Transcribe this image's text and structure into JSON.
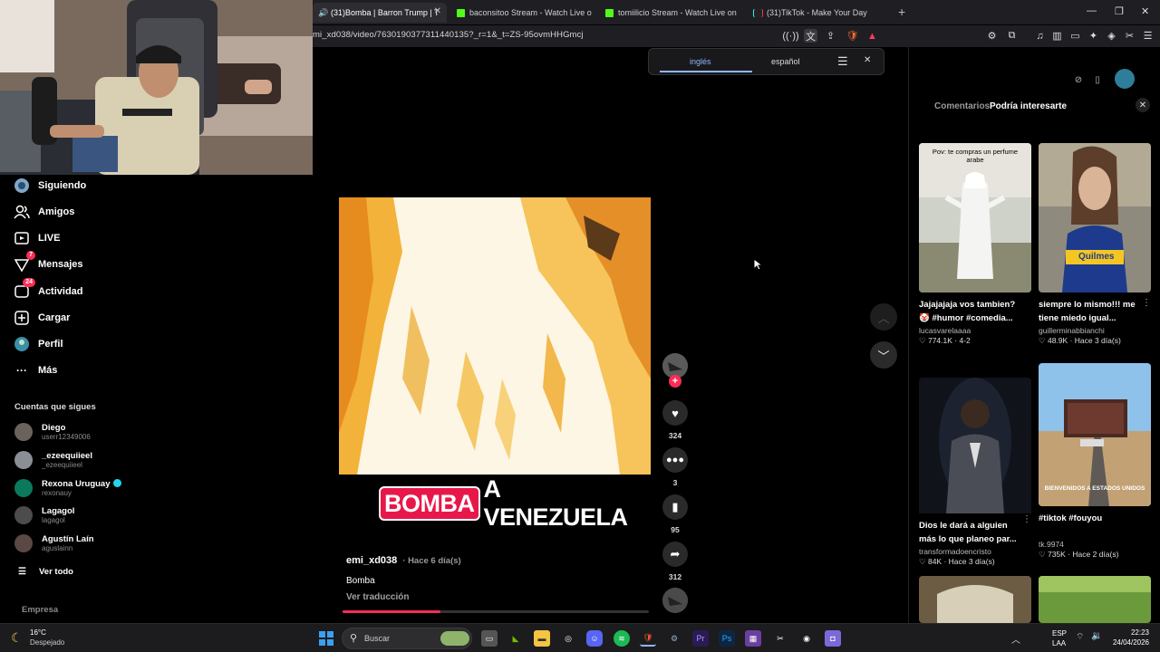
{
  "browser": {
    "tabs": [
      {
        "label": "(31)Bomba | Barron Trump | T",
        "active": true
      },
      {
        "label": "baconsitoo Stream - Watch Live o",
        "active": false
      },
      {
        "label": "tomiilicio Stream - Watch Live on",
        "active": false
      },
      {
        "label": "(31)TikTok - Make Your Day",
        "active": false
      }
    ],
    "url": "mi_xd038/video/7630190377311440135?_r=1&_t=ZS-95ovmHHGmcj"
  },
  "translate": {
    "lang1": "inglés",
    "lang2": "español"
  },
  "sidebar": {
    "nav": [
      {
        "label": "Siguiendo",
        "icon": "following-icon"
      },
      {
        "label": "Amigos",
        "icon": "friends-icon"
      },
      {
        "label": "LIVE",
        "icon": "live-icon"
      },
      {
        "label": "Mensajes",
        "icon": "messages-icon",
        "badge": "7"
      },
      {
        "label": "Actividad",
        "icon": "activity-icon",
        "badge": "24"
      },
      {
        "label": "Cargar",
        "icon": "upload-icon"
      },
      {
        "label": "Perfil",
        "icon": "profile-icon"
      },
      {
        "label": "Más",
        "icon": "more-icon"
      }
    ],
    "section_title": "Cuentas que sigues",
    "accounts": [
      {
        "name": "Diego",
        "handle": "userr12349006",
        "verified": false
      },
      {
        "name": "_ezeequiieel",
        "handle": "_ezeequiieel",
        "verified": false
      },
      {
        "name": "Rexona Uruguay",
        "handle": "rexonauy",
        "verified": true
      },
      {
        "name": "Lagagol",
        "handle": "lagagol",
        "verified": false
      },
      {
        "name": "Agustín Laín",
        "handle": "aguslainn",
        "verified": false
      }
    ],
    "see_all": "Ver todo",
    "footer": "Empresa"
  },
  "video": {
    "caption_highlight": "BOMBA",
    "caption_rest": "A VENEZUELA",
    "author": "emi_xd038",
    "time": "· Hace 6 día(s)",
    "description": "Bomba",
    "translate_link": "Ver traducción",
    "progress": 0.32,
    "likes": "324",
    "comments": "3",
    "saves": "95",
    "shares": "312"
  },
  "right_panel": {
    "tab_comments": "Comentarios",
    "tab_suggested": "Podría interesarte",
    "cards": [
      {
        "title": "Jajajajaja vos tambien? 🤡 #humor #comedia...",
        "user": "lucasvarelaaaa",
        "stats": "♡ 774.1K · 4-2",
        "overlay_text": "Pov: te compras un perfume arabe"
      },
      {
        "title": "siempre lo mismo!!! me tiene miedo igual...",
        "user": "guillerminabbianchi",
        "stats": "♡ 48.9K · Hace 3 día(s)",
        "overlay_text": ""
      },
      {
        "title": "Dios le dará a alguien más lo que planeo par...",
        "user": "transformadoencristo",
        "stats": "♡ 84K · Hace 3 día(s)",
        "overlay_text": ""
      },
      {
        "title": "#tiktok #fouyou",
        "user": "tk.9974",
        "stats": "♡ 735K · Hace 2 día(s)",
        "overlay_text": "BIENVENIDOS A ESTADOS UNIDOS"
      }
    ]
  },
  "taskbar": {
    "weather_temp": "16°C",
    "weather_desc": "Despejado",
    "search_placeholder": "Buscar",
    "lang_top": "ESP",
    "lang_bottom": "LAA",
    "time": "22:23",
    "date": "24/04/2026"
  },
  "colors": {
    "accent": "#fe2c55",
    "translate_accent": "#8fb6ff"
  }
}
